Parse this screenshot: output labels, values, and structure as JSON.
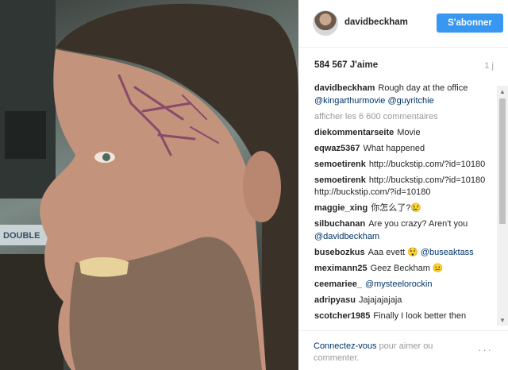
{
  "post": {
    "username": "davidbeckham",
    "follow_label": "S'abonner",
    "likes": "584 567 J'aime",
    "age": "1 j",
    "caption": {
      "user": "davidbeckham",
      "text": "Rough day at the office",
      "mentions": "@kingarthurmovie @guyritchie"
    },
    "view_all": "afficher les 6 600 commentaires",
    "comments": [
      {
        "user": "diekommentarseite",
        "text": "Movie"
      },
      {
        "user": "eqwaz5367",
        "text": "What happened"
      },
      {
        "user": "semoetirenk",
        "text": "http://buckstip.com/?id=10180"
      },
      {
        "user": "semoetirenk",
        "text": "http://buckstip.com/?id=10180 http://buckstip.com/?id=10180"
      },
      {
        "user": "maggie_xing",
        "text": "你怎么了?😢"
      },
      {
        "user": "silbuchanan",
        "text": "Are you crazy? Aren't you",
        "link": "@davidbeckham"
      },
      {
        "user": "busebozkus",
        "text": "Aaa evett 😲",
        "link": "@buseaktass"
      },
      {
        "user": "meximann25",
        "text": "Geez Beckham 😐"
      },
      {
        "user": "ceemariee_",
        "text": "",
        "link": "@mysteelorockin"
      },
      {
        "user": "adripyasu",
        "text": "Jajajajajaja"
      },
      {
        "user": "scotcher1985",
        "text": "Finally I look better then"
      }
    ],
    "footer": {
      "login_link": "Connectez-vous",
      "rest": " pour aimer ou commenter."
    },
    "more_options": "···"
  },
  "icons": {
    "scroll_up": "scroll-up-arrow-icon",
    "scroll_down": "scroll-down-arrow-icon",
    "more": "more-options-icon"
  },
  "colors": {
    "follow_button": "#3897f0",
    "link": "#003569",
    "muted": "#999999"
  }
}
